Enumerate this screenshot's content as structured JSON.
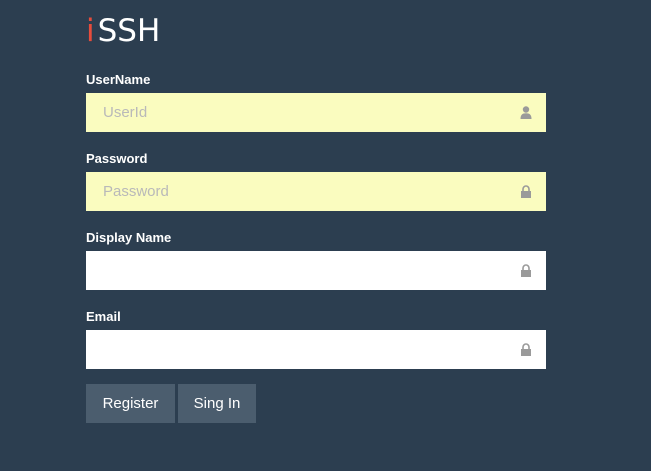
{
  "brand": {
    "accent_letter": "i",
    "name": "SSH",
    "accent_color": "#e74c3c"
  },
  "form": {
    "username": {
      "label": "UserName",
      "placeholder": "UserId",
      "value": "",
      "icon": "user-icon"
    },
    "password": {
      "label": "Password",
      "placeholder": "Password",
      "value": "",
      "icon": "lock-icon"
    },
    "display_name": {
      "label": "Display Name",
      "placeholder": "",
      "value": "",
      "icon": "lock-icon"
    },
    "email": {
      "label": "Email",
      "placeholder": "",
      "value": "",
      "icon": "lock-icon"
    }
  },
  "buttons": {
    "register_label": "Register",
    "signin_label": "Sing In"
  },
  "colors": {
    "background": "#2c3e50",
    "button": "#4b5d6e",
    "autofill": "#fafcbf",
    "icon": "#9a9a9a"
  }
}
